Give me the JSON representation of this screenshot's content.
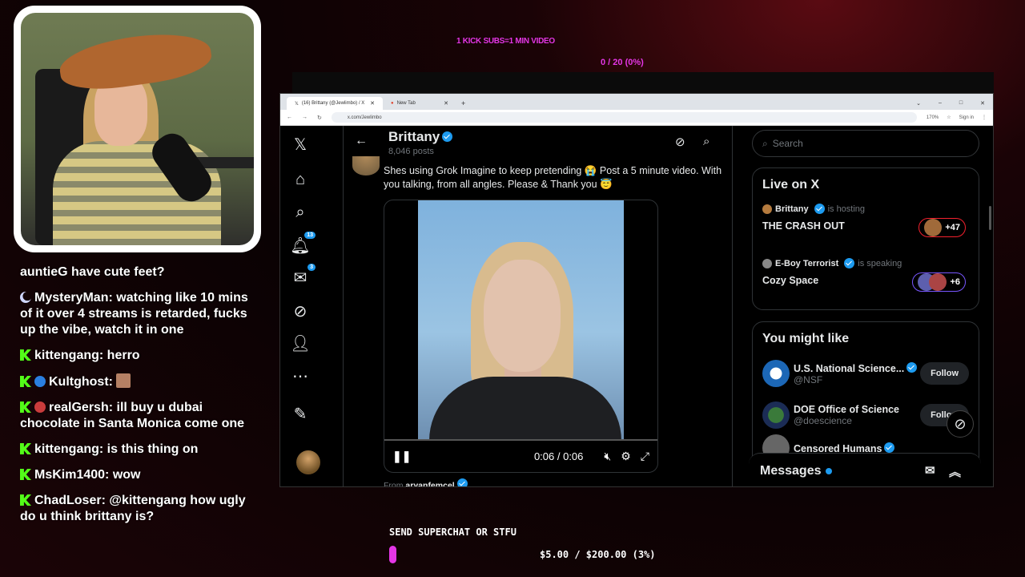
{
  "overlay": {
    "kick_goal": "1 KICK SUBS=1 MIN VIDEO",
    "kick_progress": "0 / 20 (0%)",
    "superchat_label": "SEND SUPERCHAT OR STFU",
    "superchat_amount": "$5.00 / $200.00 (3%)",
    "superchat_progress": 0.03,
    "accent_color": "#e436e6"
  },
  "chat": [
    {
      "user": "auntieG",
      "text": "have cute feet?",
      "badge": ""
    },
    {
      "user": "MysteryMan:",
      "text": "watching like 10 mins of it over 4 streams is retarded, fucks up the vibe, watch it in one",
      "badge": "moon-icon"
    },
    {
      "user": "kittengang:",
      "text": "herro",
      "badge": "kick-badge-icon"
    },
    {
      "user": "Kultghost:",
      "text": "",
      "badge": "kick-badge-icon"
    },
    {
      "user": "realGersh:",
      "text": "ill buy u dubai chocolate in Santa Monica come one",
      "badge": "kick-badge-icon"
    },
    {
      "user": "kittengang:",
      "text": "is this thing on",
      "badge": "kick-badge-icon"
    },
    {
      "user": "MsKim1400:",
      "text": "wow",
      "badge": "kick-badge-icon"
    },
    {
      "user": "ChadLoser:",
      "text": "@kittengang how ugly do u think brittany is?",
      "badge": "kick-badge-icon"
    }
  ],
  "browser": {
    "tabs": [
      {
        "label": "(16) Brittany (@Jewlimbo) / X",
        "active": true
      },
      {
        "label": "New Tab",
        "active": false
      }
    ],
    "url": "x.com/Jewlimbo",
    "zoom": "170%",
    "sign_in": "Sign in"
  },
  "x": {
    "nav": {
      "notif_count": "13",
      "msg_count": "3"
    },
    "profile": {
      "name": "Brittany",
      "posts": "8,046 posts"
    },
    "tweet": {
      "text": "Shes using Grok Imagine to keep pretending 😭 Post a 5 minute video. With you talking, from all angles. Please & Thank you 😇",
      "video_time": "0:06 / 0:06",
      "from_label": "From",
      "from_user": "aryanfemcel"
    },
    "search_placeholder": "Search",
    "live": {
      "title": "Live on X",
      "items": [
        {
          "host": "Brittany",
          "role": "is hosting",
          "title": "THE CRASH OUT",
          "count": "+47",
          "border": "#f4212e"
        },
        {
          "host": "E-Boy Terrorist",
          "role": "is speaking",
          "title": "Cozy Space",
          "count": "+6",
          "border": "#7856ff"
        }
      ]
    },
    "suggest": {
      "title": "You might like",
      "items": [
        {
          "name": "U.S. National Science...",
          "handle": "@NSF",
          "button": "Follow"
        },
        {
          "name": "DOE Office of Science",
          "handle": "@doescience",
          "button": "Follow"
        },
        {
          "name": "Censored Humans",
          "handle": "",
          "button": ""
        }
      ]
    },
    "messages": "Messages"
  }
}
